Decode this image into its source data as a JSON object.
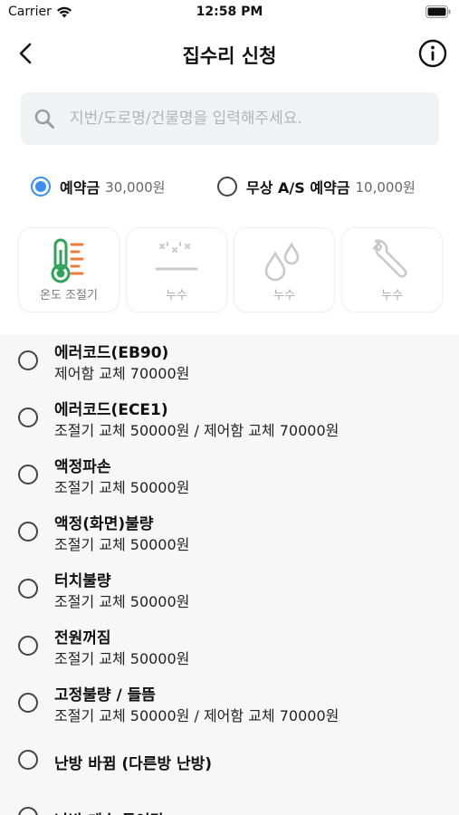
{
  "status_bar": {
    "carrier": "Carrier",
    "time": "12:58 PM"
  },
  "nav": {
    "title": "집수리 신청"
  },
  "search": {
    "placeholder": "지번/도로명/건물명을 입력해주세요."
  },
  "deposit": {
    "options": [
      {
        "label": "예약금",
        "price": "30,000원",
        "selected": true
      },
      {
        "label": "무상 A/S 예약금",
        "price": "10,000원",
        "selected": false
      }
    ]
  },
  "categories": [
    {
      "label": "온도 조절기",
      "icon": "thermometer-icon",
      "active": true
    },
    {
      "label": "누수",
      "icon": "leak-icon",
      "active": false
    },
    {
      "label": "누수",
      "icon": "water-drops-icon",
      "active": false
    },
    {
      "label": "누수",
      "icon": "wrench-icon",
      "active": false
    }
  ],
  "items": [
    {
      "title": "에러코드(EB90)",
      "desc": "제어함 교체 70000원"
    },
    {
      "title": "에러코드(ECE1)",
      "desc": "조절기 교체 50000원 / 제어함 교체 70000원"
    },
    {
      "title": "액정파손",
      "desc": "조절기 교체 50000원"
    },
    {
      "title": "액정(화면)불량",
      "desc": "조절기 교체 50000원"
    },
    {
      "title": "터치불량",
      "desc": "조절기 교체 50000원"
    },
    {
      "title": "전원꺼짐",
      "desc": "조절기 교체 50000원"
    },
    {
      "title": "고정불량 / 들뜸",
      "desc": "조절기 교체 50000원 / 제어함 교체 70000원"
    },
    {
      "title": "난방 바뀜 (다른방 난방)",
      "desc": ""
    },
    {
      "title": "난방 계속 들어감",
      "desc": ""
    }
  ],
  "colors": {
    "accent": "#3b8ff2",
    "thermo_green": "#2fa35a",
    "thermo_orange": "#ef7b3a"
  }
}
